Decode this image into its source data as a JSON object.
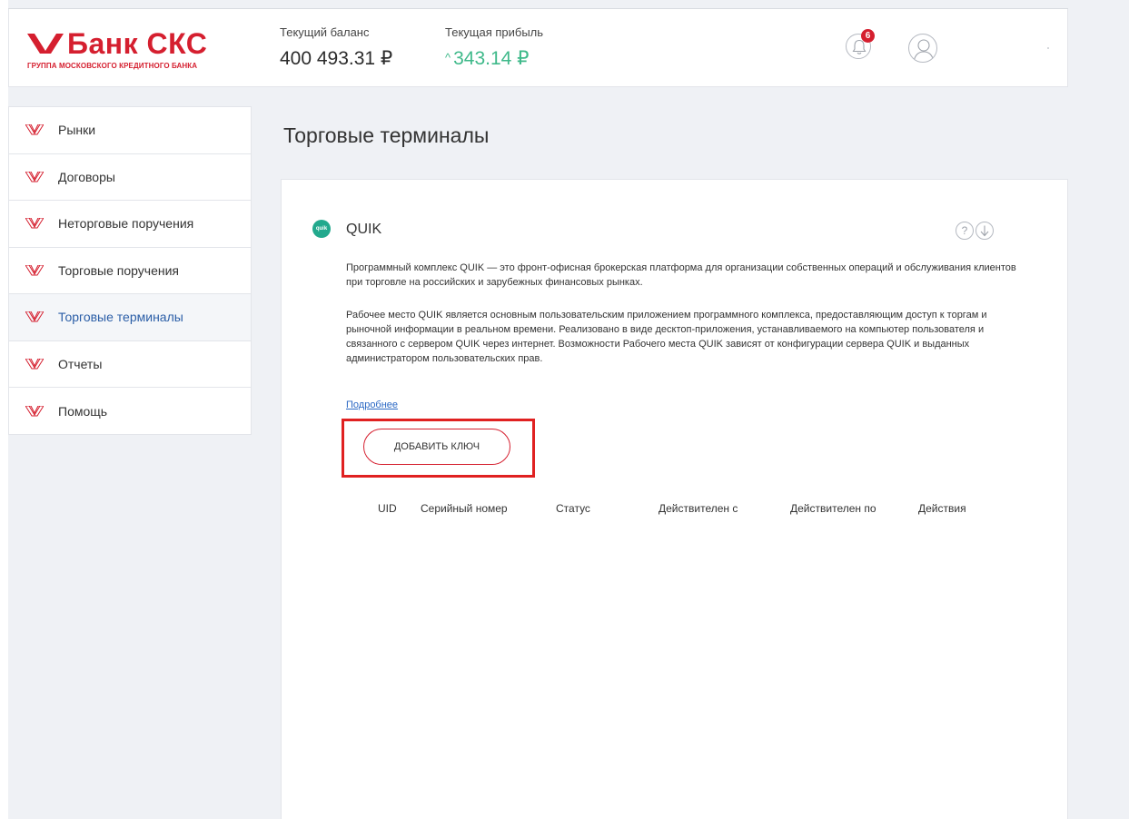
{
  "header": {
    "logo_name": "Банк СКС",
    "logo_subtitle": "ГРУППА МОСКОВСКОГО КРЕДИТНОГО БАНКА",
    "balance_label": "Текущий баланс",
    "balance_value": "400 493.31 ₽",
    "profit_label": "Текущая прибыль",
    "profit_arrow": "^",
    "profit_value": "343.14 ₽",
    "notifications_count": "6"
  },
  "sidebar": {
    "items": [
      {
        "label": "Рынки"
      },
      {
        "label": "Договоры"
      },
      {
        "label": "Неторговые поручения"
      },
      {
        "label": "Торговые поручения"
      },
      {
        "label": "Торговые терминалы"
      },
      {
        "label": "Отчеты"
      },
      {
        "label": "Помощь"
      }
    ],
    "active_index": 4
  },
  "page": {
    "title": "Торговые терминалы"
  },
  "terminal": {
    "logo_text": "quik",
    "name": "QUIK",
    "help_symbol": "?",
    "description_1": "Программный комплекс QUIK — это фронт-офисная брокерская платформа для организации собственных операций и обслуживания клиентов при торговле на российских и зарубежных финансовых рынках.",
    "description_2": "Рабочее место QUIK является основным пользовательским приложением программного комплекса, предоставляющим доступ к торгам и рыночной информации в реальном времени. Реализовано в виде десктоп-приложения, устанавливаемого на компьютер пользователя и связанного с сервером QUIK через интернет. Возможности Рабочего места QUIK зависят от конфигурации сервера QUIK и выданных администратором пользовательских прав.",
    "more_link": "Подробнее",
    "add_key_button": "ДОБАВИТЬ КЛЮЧ"
  },
  "keys_table": {
    "columns": [
      "UID",
      "Серийный номер",
      "Статус",
      "Действителен с",
      "Действителен по",
      "Действия"
    ],
    "rows": []
  },
  "colors": {
    "brand_red": "#d51f2f",
    "profit_green": "#3fb98a",
    "link_blue": "#2b68c4",
    "active_nav": "#2b5ea7",
    "highlight_red": "#e02121",
    "quik_green": "#22a98d"
  }
}
